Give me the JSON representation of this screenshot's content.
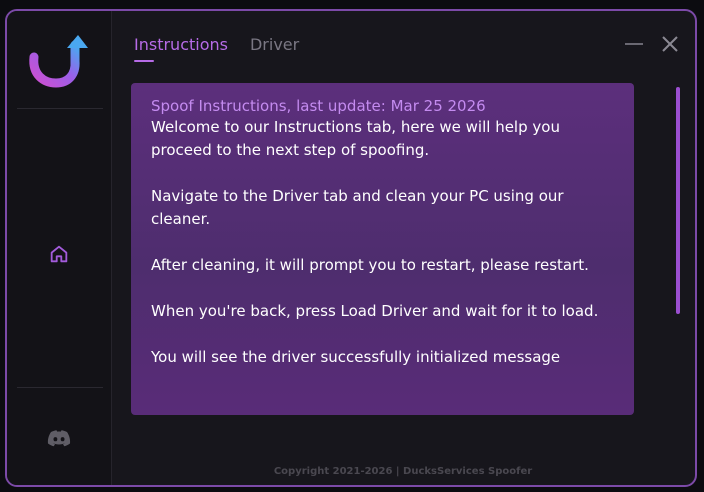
{
  "tabs": [
    {
      "label": "Instructions",
      "active": true
    },
    {
      "label": "Driver",
      "active": false
    }
  ],
  "sidebar": {
    "items": [
      {
        "icon": "home-icon"
      },
      {
        "icon": "discord-icon"
      }
    ]
  },
  "window_controls": {
    "minimize": "minimize-icon",
    "close": "close-icon"
  },
  "panel": {
    "title": "Spoof Instructions, last update: Mar 25 2026",
    "paragraphs": [
      "Welcome to our Instructions tab, here we will help you proceed to the next step of spoofing.",
      "Navigate to the Driver tab and clean your PC using our cleaner.",
      "After cleaning, it will prompt you to restart, please restart.",
      "When you're back, press Load Driver and wait for it to load.",
      "You will see the driver successfully initialized message"
    ]
  },
  "footer": {
    "text": "Copyright 2021-2026 | DucksServices Spoofer"
  },
  "colors": {
    "accent": "#b66be6",
    "panel": "#542d74",
    "background": "#17161c",
    "border": "#7c4aa8"
  }
}
